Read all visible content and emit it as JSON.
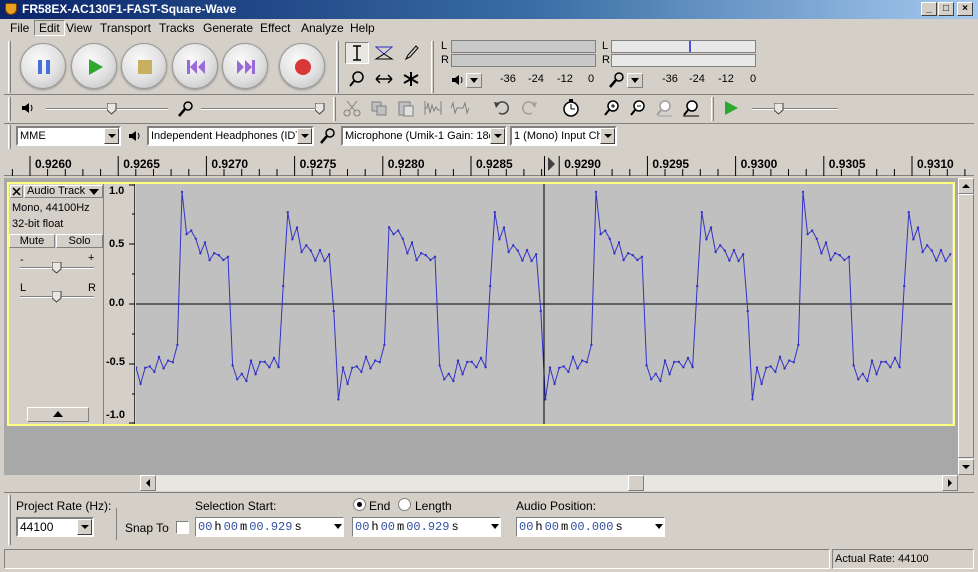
{
  "window": {
    "title": "FR58EX-AC130F1-FAST-Square-Wave",
    "minimize_glyph": "_",
    "maximize_glyph": "□",
    "close_glyph": "×"
  },
  "menu": {
    "items": [
      "File",
      "Edit",
      "View",
      "Transport",
      "Tracks",
      "Generate",
      "Effect",
      "Analyze",
      "Help"
    ],
    "active": "Edit"
  },
  "meters": {
    "playback": {
      "channels": [
        "L",
        "R"
      ],
      "ticks": [
        "-36",
        "-24",
        "-12",
        "0"
      ]
    },
    "record": {
      "channels": [
        "L",
        "R"
      ],
      "ticks": [
        "-36",
        "-24",
        "-12",
        "0"
      ]
    }
  },
  "device": {
    "host": "MME",
    "output": "Independent Headphones (IDT",
    "input": "Microphone (Umik-1  Gain: 18d",
    "channels": "1 (Mono) Input Ch"
  },
  "ruler": {
    "labels": [
      "0.9260",
      "0.9265",
      "0.9270",
      "0.9275",
      "0.9280",
      "0.9285",
      "0.9290",
      "0.9295",
      "0.9300",
      "0.9305",
      "0.9310"
    ]
  },
  "track": {
    "name": "Audio Track",
    "format": "Mono, 44100Hz",
    "bit_depth": "32-bit float",
    "mute_label": "Mute",
    "solo_label": "Solo",
    "gain_minus": "-",
    "gain_plus": "+",
    "pan_left": "L",
    "pan_right": "R",
    "y_labels": [
      "1.0",
      "0.5",
      "0.0",
      "-0.5",
      "-1.0"
    ],
    "waveform_color": "#3232c8"
  },
  "selection_bar": {
    "project_rate_label": "Project Rate (Hz):",
    "project_rate_value": "44100",
    "snap_to_label": "Snap To",
    "selection_start_label": "Selection Start:",
    "end_label": "End",
    "length_label": "Length",
    "end_selected": true,
    "selection_start": {
      "h": "00",
      "m": "00",
      "s": "00.929"
    },
    "selection_end": {
      "h": "00",
      "m": "00",
      "s": "00.929"
    },
    "audio_position_label": "Audio Position:",
    "audio_position": {
      "h": "00",
      "m": "00",
      "s": "00.000"
    },
    "unit_h": "h",
    "unit_m": "m",
    "unit_s": "s"
  },
  "status": {
    "actual_rate": "Actual Rate: 44100"
  }
}
